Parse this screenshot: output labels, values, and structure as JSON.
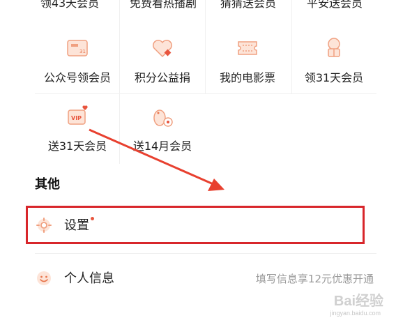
{
  "top_row": [
    "领43天会员",
    "免费看热播剧",
    "猜猜送会员",
    "平安送会员"
  ],
  "grid_items": [
    {
      "label": "公众号领会员",
      "icon": "vip-card-icon"
    },
    {
      "label": "积分公益捐",
      "icon": "heart-donate-icon"
    },
    {
      "label": "我的电影票",
      "icon": "ticket-icon"
    },
    {
      "label": "领31天会员",
      "icon": "gift-tree-icon"
    },
    {
      "label": "送31天会员",
      "icon": "vip-heart-icon"
    },
    {
      "label": "送14月会员",
      "icon": "penguin-icon"
    }
  ],
  "section": {
    "title": "其他"
  },
  "menu": [
    {
      "label": "设置",
      "icon": "gear-icon",
      "has_dot": true,
      "hint": ""
    },
    {
      "label": "个人信息",
      "icon": "smile-face-icon",
      "has_dot": false,
      "hint": "填写信息享12元优惠开通"
    }
  ],
  "watermark": {
    "text": "Bai经验",
    "sub": "jingyan.baidu.com"
  },
  "colors": {
    "accent": "#e8553e",
    "highlight": "#d8262b",
    "icon_tint": "#f0a080"
  }
}
